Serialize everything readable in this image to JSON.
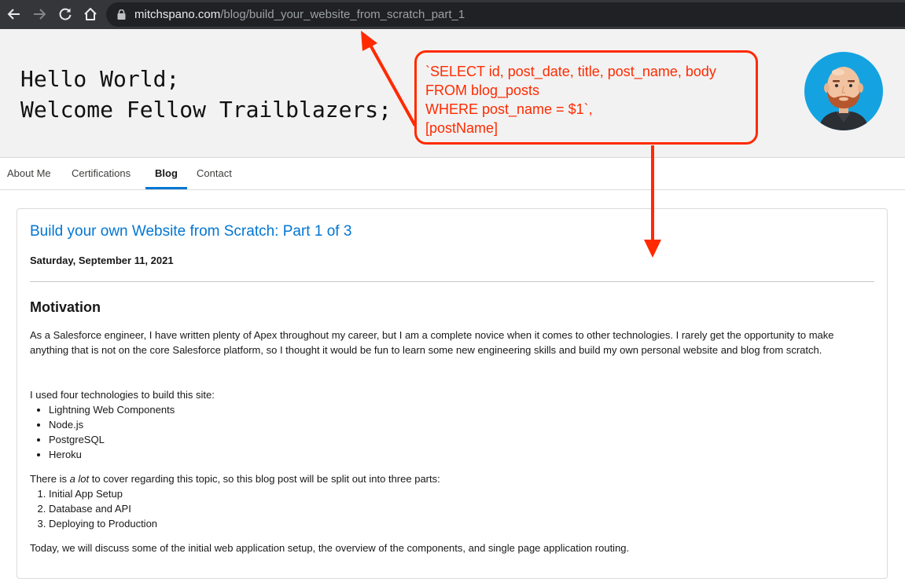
{
  "browser": {
    "url_host": "mitchspano.com",
    "url_path": "/blog/build_your_website_from_scratch_part_1"
  },
  "header": {
    "line1": "Hello World;",
    "line2": "Welcome Fellow Trailblazers;"
  },
  "tabs": [
    {
      "label": "About Me"
    },
    {
      "label": "Certifications"
    },
    {
      "label": "Blog",
      "active": true
    },
    {
      "label": "Contact"
    }
  ],
  "post": {
    "title": "Build your own Website from Scratch: Part 1 of 3",
    "date": "Saturday, September 11, 2021",
    "heading": "Motivation",
    "intro": "As a Salesforce engineer, I have written plenty of Apex throughout my career, but I am a complete novice when it comes to other technologies. I rarely get the opportunity to make anything that is not on the core Salesforce platform, so I thought it would be fun to learn some new engineering skills and build my own personal website and blog from scratch.",
    "tech_intro": "I used four technologies to build this site:",
    "tech_list": [
      "Lightning Web Components",
      "Node.js",
      "PostgreSQL",
      "Heroku"
    ],
    "parts_intro_pre": "There is ",
    "parts_intro_em": "a lot",
    "parts_intro_post": " to cover regarding this topic, so this blog post will be split out into three parts:",
    "parts_list": [
      "Initial App Setup",
      "Database and API",
      "Deploying to Production"
    ],
    "closing": "Today, we will discuss some of the initial web application setup, the overview of the components, and single page application routing."
  },
  "annotation": {
    "text": "`SELECT id, post_date, title, post_name, body\nFROM blog_posts\nWHERE post_name = $1`,\n[postName]",
    "color": "#ff2a00"
  },
  "colors": {
    "link_blue": "#0176d3",
    "annotation_red": "#ff2a00"
  }
}
